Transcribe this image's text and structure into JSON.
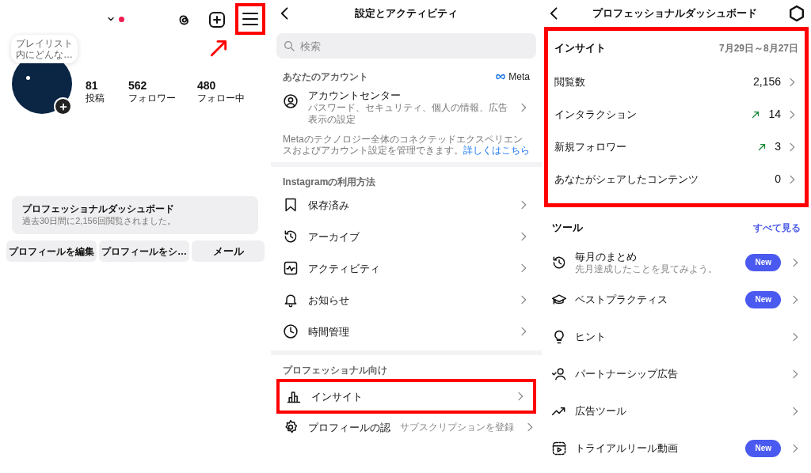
{
  "profile": {
    "has_notification": true,
    "menu_highlighted": true,
    "note": "プレイリスト内にどんな…",
    "stats": [
      {
        "value": "81",
        "label": "投稿"
      },
      {
        "value": "562",
        "label": "フォロワー"
      },
      {
        "value": "480",
        "label": "フォロー中"
      }
    ],
    "dashboard_card": {
      "title": "プロフェッショナルダッシュボード",
      "subtitle": "過去30日間に2,156回閲覧されました。"
    },
    "buttons": [
      "プロフィールを編集",
      "プロフィールをシ…",
      "メール"
    ]
  },
  "settings": {
    "title": "設定とアクティビティ",
    "search": {
      "placeholder": "検索"
    },
    "sections": [
      {
        "title": "あなたのアカウント",
        "brand": "Meta",
        "items": [
          {
            "label": "アカウントセンター",
            "subtitle": "パスワード、セキュリティ、個人の情報、広告表示の設定",
            "highlighted": false
          }
        ],
        "footnote": {
          "text": "Metaのテクノロジー全体のコネクテッドエクスペリエンスおよびアカウント設定を管理できます。",
          "link": "詳しくはこちら"
        }
      },
      {
        "title": "Instagramの利用方法",
        "items": [
          {
            "label": "保存済み",
            "highlighted": false
          },
          {
            "label": "アーカイブ",
            "highlighted": false
          },
          {
            "label": "アクティビティ",
            "highlighted": false
          },
          {
            "label": "お知らせ",
            "highlighted": false
          },
          {
            "label": "時間管理",
            "highlighted": false
          }
        ]
      },
      {
        "title": "プロフェッショナル向け",
        "items": [
          {
            "label": "インサイト",
            "highlighted": true
          },
          {
            "label": "プロフィールの認",
            "value": "サブスクリプションを登録",
            "highlighted": false
          }
        ]
      }
    ]
  },
  "dashboard": {
    "title": "プロフェッショナルダッシュボード",
    "insights": {
      "highlighted": true,
      "title": "インサイト",
      "date_range": "7月29日～8月27日",
      "metrics": [
        {
          "label": "閲覧数",
          "value": "2,156",
          "trend_up": false
        },
        {
          "label": "インタラクション",
          "value": "14",
          "trend_up": true
        },
        {
          "label": "新規フォロワー",
          "value": "3",
          "trend_up": true
        },
        {
          "label": "あなたがシェアしたコンテンツ",
          "value": "0",
          "trend_up": false
        }
      ]
    },
    "tools": {
      "title": "ツール",
      "see_all": "すべて見る",
      "items": [
        {
          "label": "毎月のまとめ",
          "subtitle": "先月達成したことを見てみよう。",
          "badge": "New"
        },
        {
          "label": "ベストプラクティス",
          "badge": "New"
        },
        {
          "label": "ヒント"
        },
        {
          "label": "パートナーシップ広告"
        },
        {
          "label": "広告ツール"
        },
        {
          "label": "トライアルリール動画",
          "badge": "New"
        }
      ]
    }
  }
}
